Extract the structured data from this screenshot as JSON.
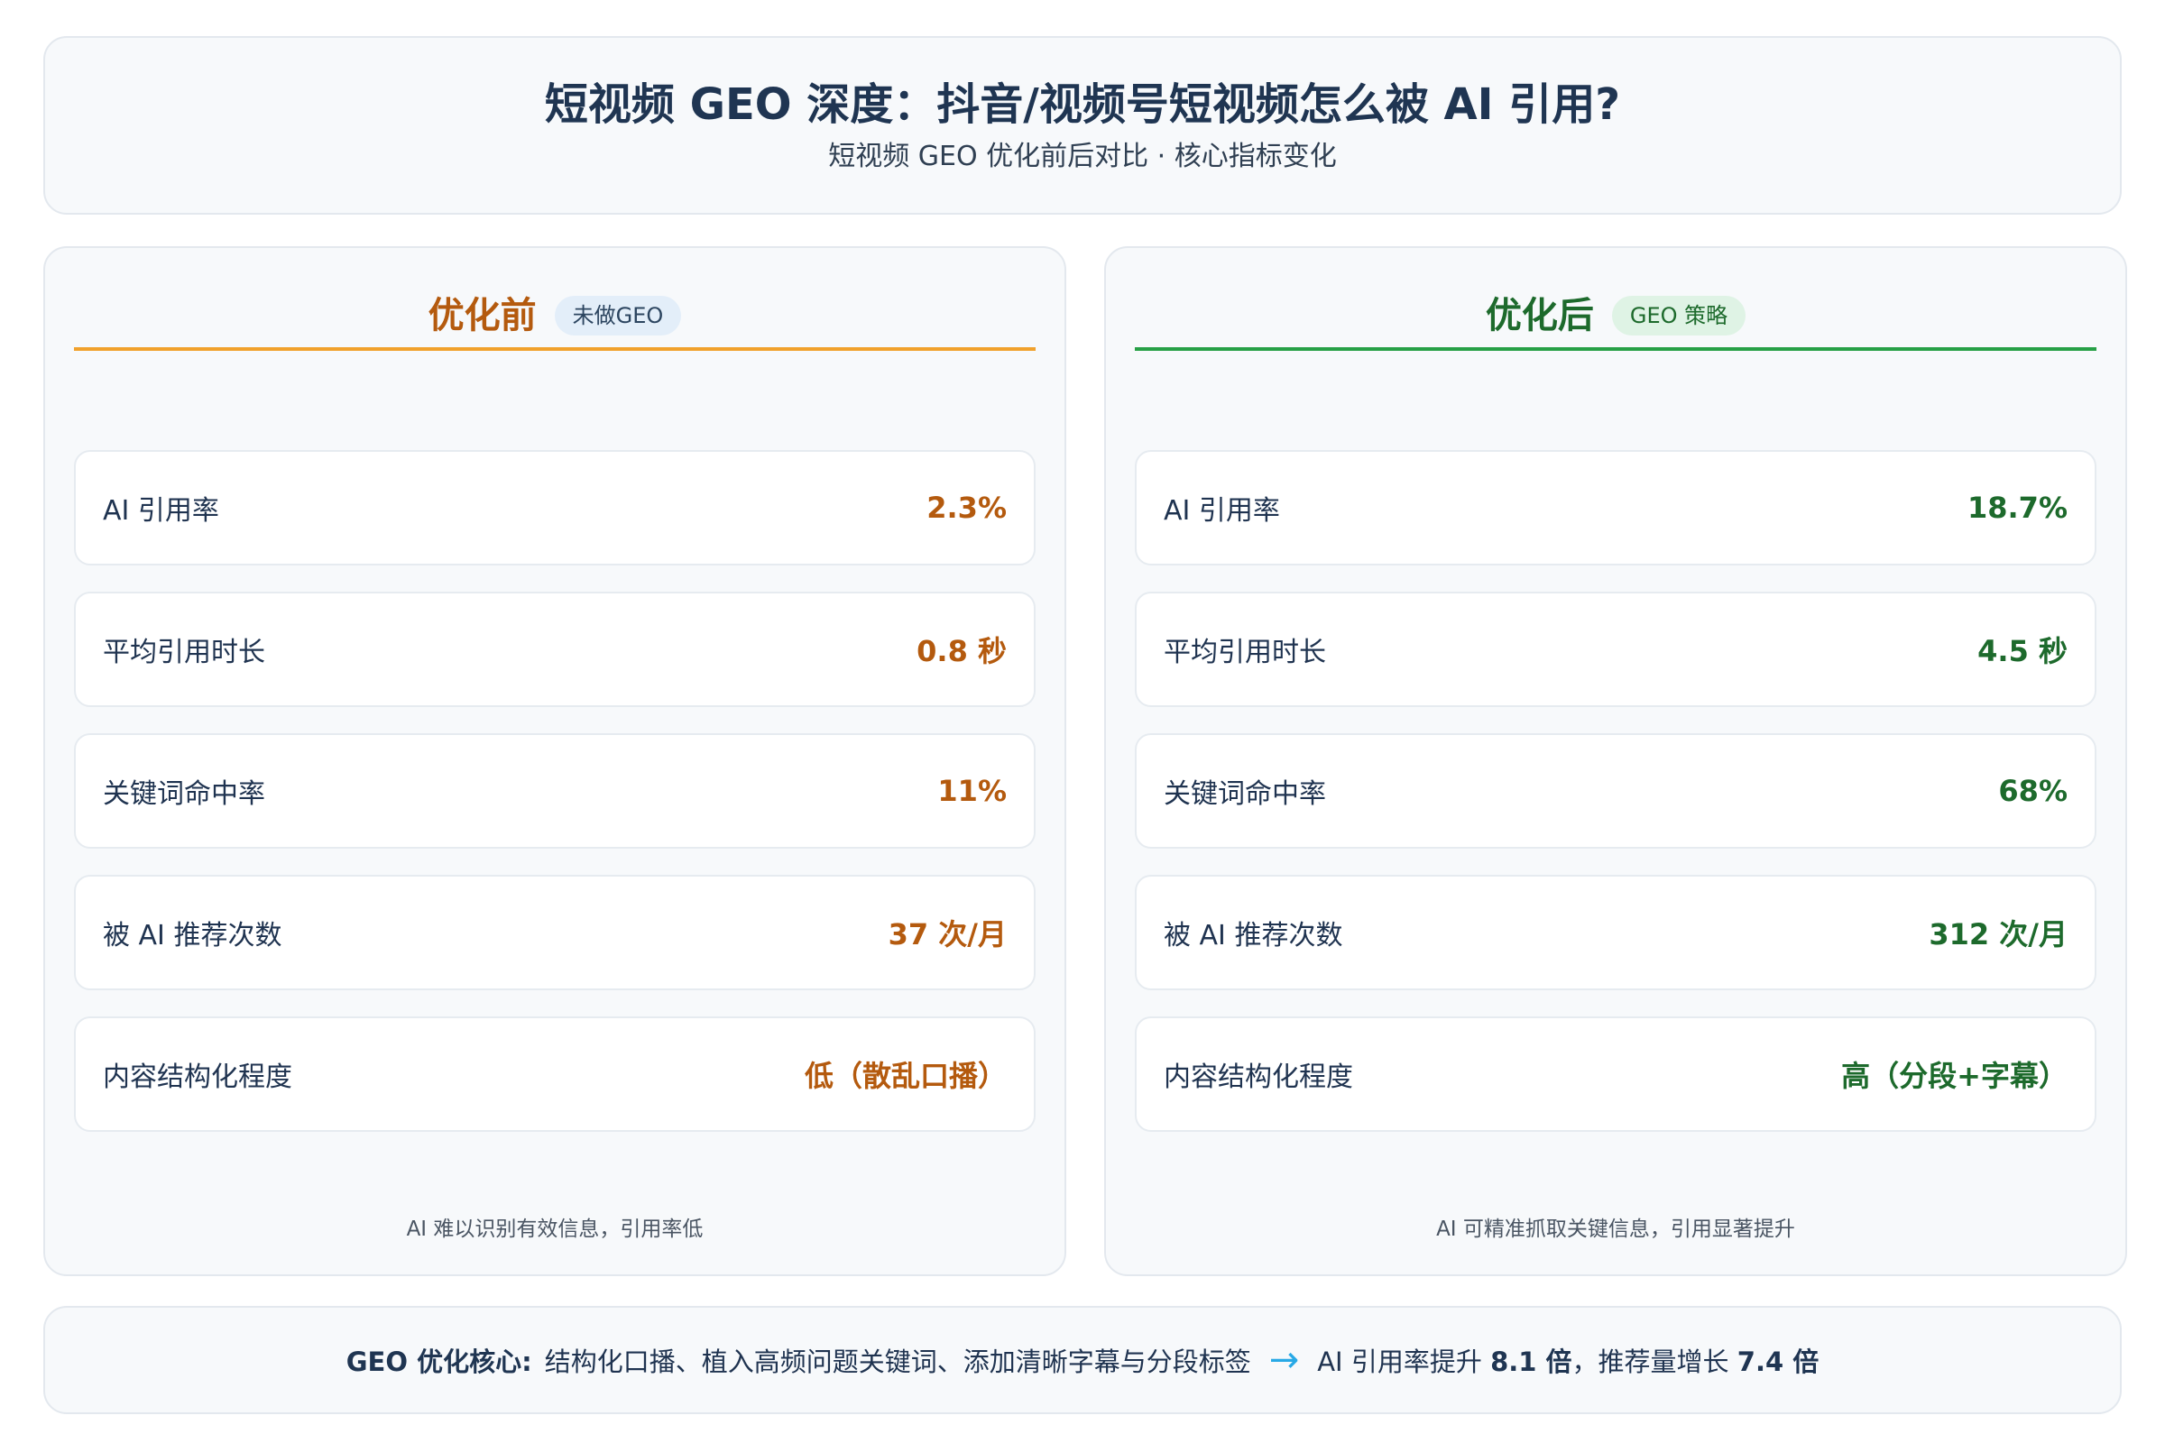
{
  "header": {
    "title": "短视频 GEO 深度：抖音/视频号短视频怎么被 AI 引用?",
    "subtitle": "短视频 GEO 优化前后对比 · 核心指标变化"
  },
  "before": {
    "title": "优化前",
    "badge": "未做GEO",
    "metrics": [
      {
        "label": "AI 引用率",
        "value": "2.3%"
      },
      {
        "label": "平均引用时长",
        "value": "0.8 秒"
      },
      {
        "label": "关键词命中率",
        "value": "11%"
      },
      {
        "label": "被 AI 推荐次数",
        "value": "37 次/月"
      },
      {
        "label": "内容结构化程度",
        "value": "低（散乱口播）"
      }
    ],
    "note": "AI 难以识别有效信息，引用率低"
  },
  "after": {
    "title": "优化后",
    "badge": "GEO 策略",
    "metrics": [
      {
        "label": "AI 引用率",
        "value": "18.7%"
      },
      {
        "label": "平均引用时长",
        "value": "4.5 秒"
      },
      {
        "label": "关键词命中率",
        "value": "68%"
      },
      {
        "label": "被 AI 推荐次数",
        "value": "312 次/月"
      },
      {
        "label": "内容结构化程度",
        "value": "高（分段+字幕）"
      }
    ],
    "note": "AI 可精准抓取关键信息，引用显著提升"
  },
  "footer": {
    "key": "GEO 优化核心:",
    "text": "结构化口播、植入高频问题关键词、添加清晰字幕与分段标签",
    "arrow": "→",
    "result_prefix": "AI 引用率提升",
    "result_num1": "8.1 倍",
    "result_mid": "，推荐量增长",
    "result_num2": "7.4 倍"
  },
  "colors": {
    "before_accent": "#f1a12c",
    "before_value": "#b45a0e",
    "after_accent": "#27a046",
    "after_value": "#1d6a2c",
    "arrow": "#28a9e6"
  }
}
